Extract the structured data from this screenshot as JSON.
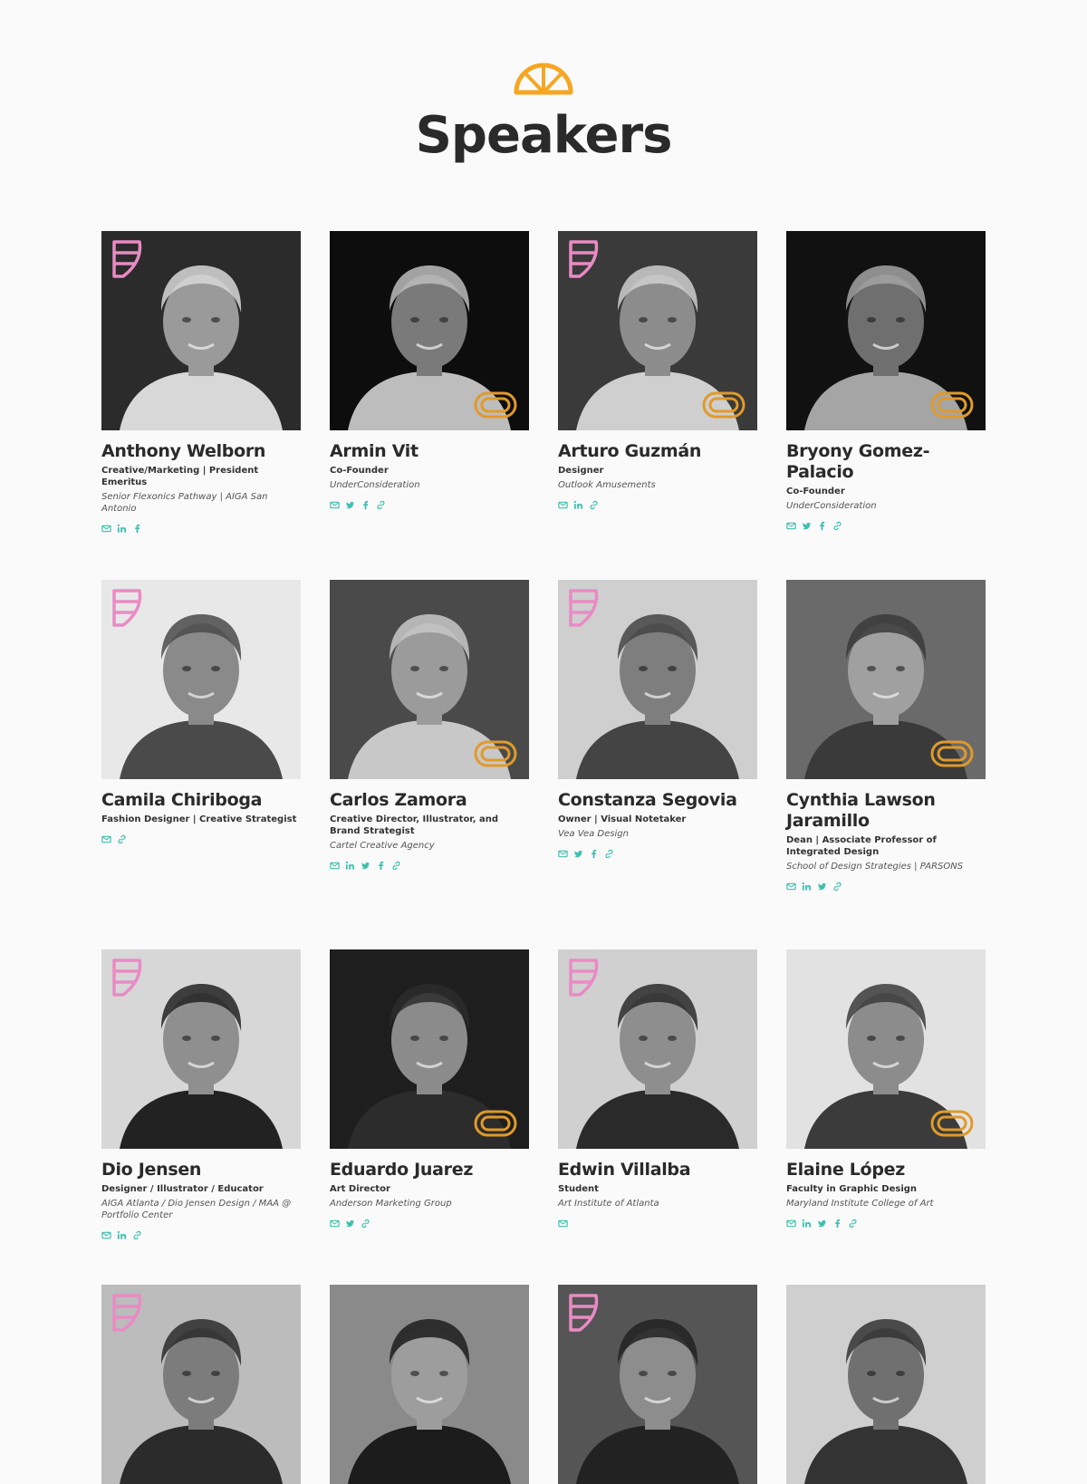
{
  "header": {
    "logo_icon": "half-sun-icon",
    "title": "Speakers"
  },
  "colors": {
    "accent_orange": "#f5a623",
    "accent_pink": "#e98bc4",
    "social_teal": "#3fbfae",
    "text_dark": "#2a2a2a"
  },
  "speakers": [
    {
      "name": "Anthony Welborn",
      "role": "Creative/Marketing | President Emeritus",
      "org": "Senior Flexonics Pathway | AIGA San Antonio",
      "socials": [
        "email",
        "linkedin",
        "facebook"
      ],
      "badge": "pink"
    },
    {
      "name": "Armin Vit",
      "role": "Co-Founder",
      "org": "UnderConsideration",
      "socials": [
        "email",
        "twitter",
        "facebook",
        "link"
      ],
      "badge": "orange"
    },
    {
      "name": "Arturo Guzmán",
      "role": "Designer",
      "org": "Outlook Amusements",
      "socials": [
        "email",
        "linkedin",
        "link"
      ],
      "badge": "both"
    },
    {
      "name": "Bryony Gomez-Palacio",
      "role": "Co-Founder",
      "org": "UnderConsideration",
      "socials": [
        "email",
        "twitter",
        "facebook",
        "link"
      ],
      "badge": "orange"
    },
    {
      "name": "Camila Chiriboga",
      "role": "Fashion Designer | Creative Strategist",
      "org": "",
      "socials": [
        "email",
        "link"
      ],
      "badge": "pink"
    },
    {
      "name": "Carlos Zamora",
      "role": "Creative Director, Illustrator, and Brand Strategist",
      "org": "Cartel Creative Agency",
      "socials": [
        "email",
        "linkedin",
        "twitter",
        "facebook",
        "link"
      ],
      "badge": "orange"
    },
    {
      "name": "Constanza Segovia",
      "role": "Owner | Visual Notetaker",
      "org": "Vea Vea Design",
      "socials": [
        "email",
        "twitter",
        "facebook",
        "link"
      ],
      "badge": "pink"
    },
    {
      "name": "Cynthia Lawson Jaramillo",
      "role": "Dean | Associate Professor of Integrated Design",
      "org": "School of Design Strategies | PARSONS",
      "socials": [
        "email",
        "linkedin",
        "twitter",
        "link"
      ],
      "badge": "orange"
    },
    {
      "name": "Dio Jensen",
      "role": "Designer / Illustrator / Educator",
      "org": "AIGA Atlanta / Dio Jensen Design / MAA @ Portfolio Center",
      "socials": [
        "email",
        "linkedin",
        "link"
      ],
      "badge": "pink"
    },
    {
      "name": "Eduardo Juarez",
      "role": "Art Director",
      "org": "Anderson Marketing Group",
      "socials": [
        "email",
        "twitter",
        "link"
      ],
      "badge": "orange"
    },
    {
      "name": "Edwin Villalba",
      "role": "Student",
      "org": "Art Institute of Atlanta",
      "socials": [
        "email"
      ],
      "badge": "pink"
    },
    {
      "name": "Elaine López",
      "role": "Faculty in Graphic Design",
      "org": "Maryland Institute College of Art",
      "socials": [
        "email",
        "linkedin",
        "twitter",
        "facebook",
        "link"
      ],
      "badge": "orange"
    },
    {
      "name": "",
      "role": "",
      "org": "",
      "socials": [],
      "badge": "pink"
    },
    {
      "name": "",
      "role": "",
      "org": "",
      "socials": [],
      "badge": "none"
    },
    {
      "name": "",
      "role": "",
      "org": "",
      "socials": [],
      "badge": "pink"
    },
    {
      "name": "",
      "role": "",
      "org": "",
      "socials": [],
      "badge": "none"
    }
  ]
}
